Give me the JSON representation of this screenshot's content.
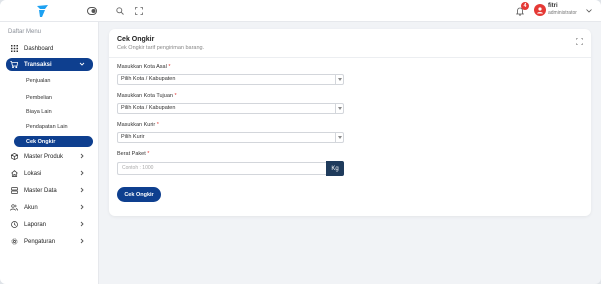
{
  "topbar": {
    "user": {
      "name": "fitri",
      "role": "administrator"
    },
    "notification_count": "4"
  },
  "sidebar": {
    "heading": "Daftar Menu",
    "items": [
      {
        "label": "Dashboard",
        "icon": "grid-icon"
      },
      {
        "label": "Transaksi",
        "icon": "cart-icon",
        "active": true,
        "expanded": true,
        "children": [
          {
            "label": "Penjualan"
          },
          {
            "label": "Pembelian"
          },
          {
            "label": "Biaya Lain"
          },
          {
            "label": "Pendapatan Lain"
          },
          {
            "label": "Cek Ongkir",
            "active": true
          }
        ]
      },
      {
        "label": "Master Produk",
        "icon": "box-icon"
      },
      {
        "label": "Lokasi",
        "icon": "home-icon"
      },
      {
        "label": "Master Data",
        "icon": "database-icon"
      },
      {
        "label": "Akun",
        "icon": "users-icon"
      },
      {
        "label": "Laporan",
        "icon": "clock-icon"
      },
      {
        "label": "Pengaturan",
        "icon": "gear-icon"
      }
    ]
  },
  "card": {
    "title": "Cek Ongkir",
    "subtitle": "Cek Ongkir tarif pengiriman barang.",
    "fields": {
      "origin": {
        "label": "Masukkan Kota Asal",
        "required_mark": "*",
        "value": "Pilih Kota / Kabupaten"
      },
      "destination": {
        "label": "Masukkan Kota Tujuan",
        "required_mark": "*",
        "value": "Pilih Kota / Kabupaten"
      },
      "courier": {
        "label": "Masukkan Kurir",
        "required_mark": "*",
        "value": "Pilih Kurir"
      },
      "weight": {
        "label": "Berat Paket",
        "required_mark": "*",
        "placeholder": "Contoh : 1000",
        "unit": "Kg"
      }
    },
    "submit_label": "Cek Ongkir"
  },
  "colors": {
    "primary": "#0e3f8f",
    "unit_addon": "#1f3b5c",
    "badge": "#e53935",
    "logo": "#1da1f2"
  }
}
